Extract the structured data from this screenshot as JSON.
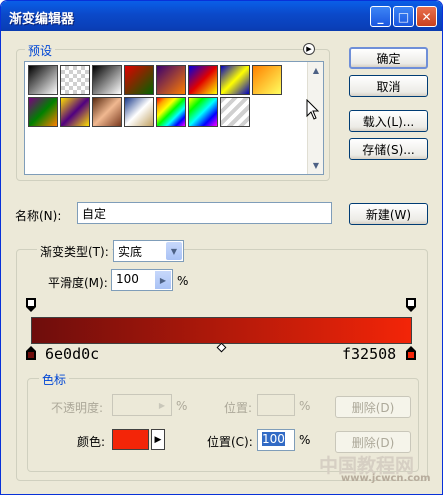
{
  "window": {
    "title": "渐变编辑器"
  },
  "titlebar_buttons": {
    "minimize": "_",
    "maximize": "□",
    "close": "✕"
  },
  "presets": {
    "legend": "预设",
    "swatches": [
      {
        "name": "black-white",
        "bg": "linear-gradient(135deg,#000,#fff)"
      },
      {
        "name": "transparent",
        "bg": "repeating-conic-gradient(#d0d0d0 0 25%,#fff 0 50%) 0 0/8px 8px"
      },
      {
        "name": "black-white-2",
        "bg": "linear-gradient(135deg,#000,#fff)"
      },
      {
        "name": "red-green",
        "bg": "linear-gradient(135deg,#e00000,#006400)"
      },
      {
        "name": "violet-orange",
        "bg": "linear-gradient(135deg,#3a006f,#ff7f00)"
      },
      {
        "name": "blue-red-yellow",
        "bg": "linear-gradient(135deg,#0000e0,#e00000,#ffff00)"
      },
      {
        "name": "blue-yellow-blue",
        "bg": "linear-gradient(135deg,#0000c0,#ffff00,#0000c0)"
      },
      {
        "name": "orange-yellow",
        "bg": "linear-gradient(135deg,#ff8000,#ffff60)"
      },
      {
        "name": "violet-green-orange",
        "bg": "linear-gradient(135deg,#7a0080,#008000,#ff8000)"
      },
      {
        "name": "yellow-violet",
        "bg": "linear-gradient(135deg,#ffe000,#500080,#ffe000)"
      },
      {
        "name": "copper",
        "bg": "linear-gradient(135deg,#5a2a10,#f0b890,#7a3a20)"
      },
      {
        "name": "chrome",
        "bg": "linear-gradient(135deg,#1a3a8a,#fff,#c0a060)"
      },
      {
        "name": "spectrum",
        "bg": "linear-gradient(135deg,red,orange,yellow,lime,cyan,blue,magenta)"
      },
      {
        "name": "transparent-rainbow",
        "bg": "linear-gradient(135deg,#ff0,#0f0,#0ff,#00f,#f0f)"
      },
      {
        "name": "transparent-stripes",
        "bg": "repeating-linear-gradient(135deg,#d0d0d0 0 4px,#fff 4px 8px)"
      }
    ]
  },
  "right_buttons": {
    "ok": "确定",
    "cancel": "取消",
    "load": "载入(L)...",
    "save": "存储(S)..."
  },
  "name_field": {
    "label": "名称(N):",
    "value": "自定",
    "new_button": "新建(W)"
  },
  "gradient_type": {
    "label": "渐变类型(T):",
    "value": "实底"
  },
  "smoothness": {
    "label": "平滑度(M):",
    "value": "100",
    "unit": "%"
  },
  "gradient": {
    "start_color": "#6e0d0c",
    "end_color": "#f32508",
    "start_label": "6e0d0c",
    "end_label": "f32508"
  },
  "stops": {
    "legend": "色标",
    "opacity_label": "不透明度:",
    "opacity_unit": "%",
    "opacity_location_label": "位置:",
    "opacity_location_unit": "%",
    "opacity_delete": "删除(D)",
    "color_label": "颜色:",
    "color_value": "#f32508",
    "color_location_label": "位置(C):",
    "color_location_value": "100",
    "color_location_unit": "%",
    "color_delete": "删除(D)"
  },
  "watermark": {
    "text": "中国教程网",
    "url": "www.jcwcn.com"
  }
}
